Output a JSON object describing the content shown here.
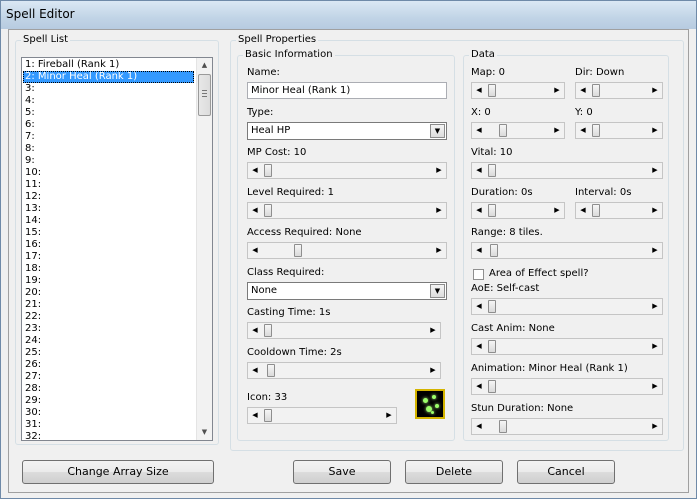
{
  "window": {
    "title": "Spell Editor"
  },
  "spell_list": {
    "legend": "Spell List",
    "items": [
      "1: Fireball (Rank 1)",
      "2: Minor Heal (Rank 1)",
      "3:",
      "4:",
      "5:",
      "6:",
      "7:",
      "8:",
      "9:",
      "10:",
      "11:",
      "12:",
      "13:",
      "14:",
      "15:",
      "16:",
      "17:",
      "18:",
      "19:",
      "20:",
      "21:",
      "22:",
      "23:",
      "24:",
      "25:",
      "26:",
      "27:",
      "28:",
      "29:",
      "30:",
      "31:",
      "32:"
    ],
    "selected_index": 1
  },
  "properties": {
    "legend": "Spell Properties",
    "basic": {
      "legend": "Basic Information",
      "name_label": "Name:",
      "name_value": "Minor Heal (Rank 1)",
      "type_label": "Type:",
      "type_value": "Heal HP",
      "mp_cost_label": "MP Cost: 10",
      "level_label": "Level Required: 1",
      "access_label": "Access Required: None",
      "class_label": "Class Required:",
      "class_value": "None",
      "casting_label": "Casting Time: 1s",
      "cooldown_label": "Cooldown Time: 2s",
      "icon_label": "Icon: 33"
    },
    "data": {
      "legend": "Data",
      "map_label": "Map: 0",
      "dir_label": "Dir: Down",
      "x_label": "X: 0",
      "y_label": "Y: 0",
      "vital_label": "Vital: 10",
      "duration_label": "Duration: 0s",
      "interval_label": "Interval: 0s",
      "range_label": "Range: 8 tiles.",
      "aoe_checkbox_label": "Area of Effect spell?",
      "aoe_label": "AoE: Self-cast",
      "cast_anim_label": "Cast Anim: None",
      "animation_label": "Animation: Minor Heal (Rank 1)",
      "stun_label": "Stun Duration: None"
    }
  },
  "buttons": {
    "change_array": "Change Array Size",
    "save": "Save",
    "delete": "Delete",
    "cancel": "Cancel"
  },
  "icons": {
    "left": "◀",
    "right": "▶",
    "up": "▲",
    "down": "▼"
  }
}
